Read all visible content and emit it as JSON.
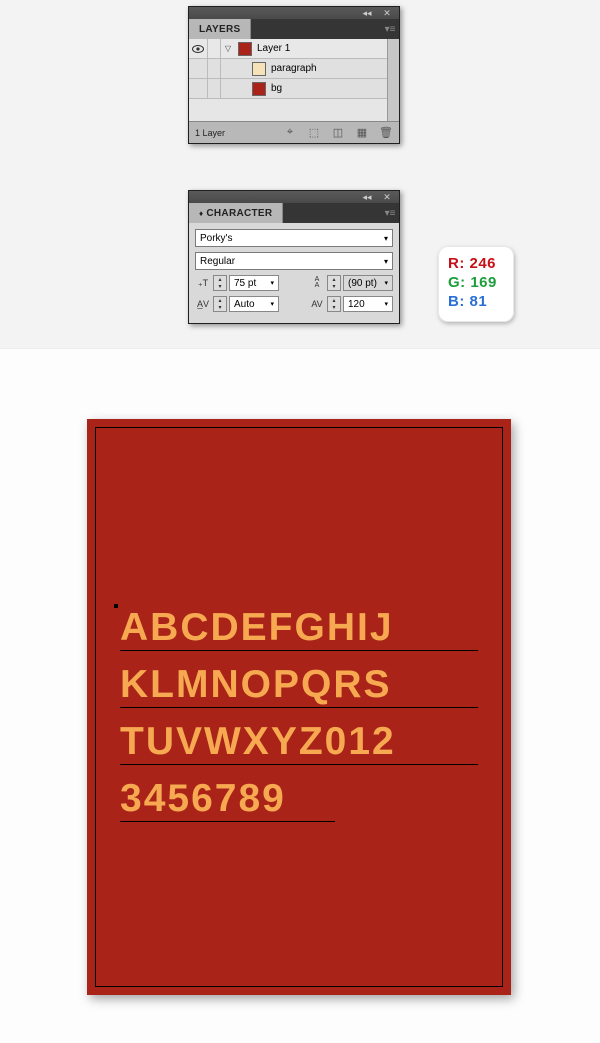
{
  "layers_panel": {
    "title": "LAYERS",
    "rows": [
      {
        "name": "Layer 1",
        "color": "#a92318",
        "expanded": true
      },
      {
        "name": "paragraph",
        "color": "#f5e2b8"
      },
      {
        "name": "bg",
        "color": "#a92318"
      }
    ],
    "footer_count": "1 Layer"
  },
  "character_panel": {
    "title": "CHARACTER",
    "font_family": "Porky's",
    "font_style": "Regular",
    "font_size": "75 pt",
    "leading": "(90 pt)",
    "kerning": "Auto",
    "tracking": "120"
  },
  "rgb": {
    "r_label": "R:",
    "r_value": "246",
    "g_label": "G:",
    "g_value": "169",
    "b_label": "B:",
    "b_value": "81"
  },
  "artboard": {
    "bg_color": "#a92318",
    "text_color": "#f6a951",
    "lines": [
      "ABCDEFGHIJ",
      "KLMNOPQRS",
      "TUVWXYZ012",
      "3456789"
    ]
  },
  "chart_data": null
}
